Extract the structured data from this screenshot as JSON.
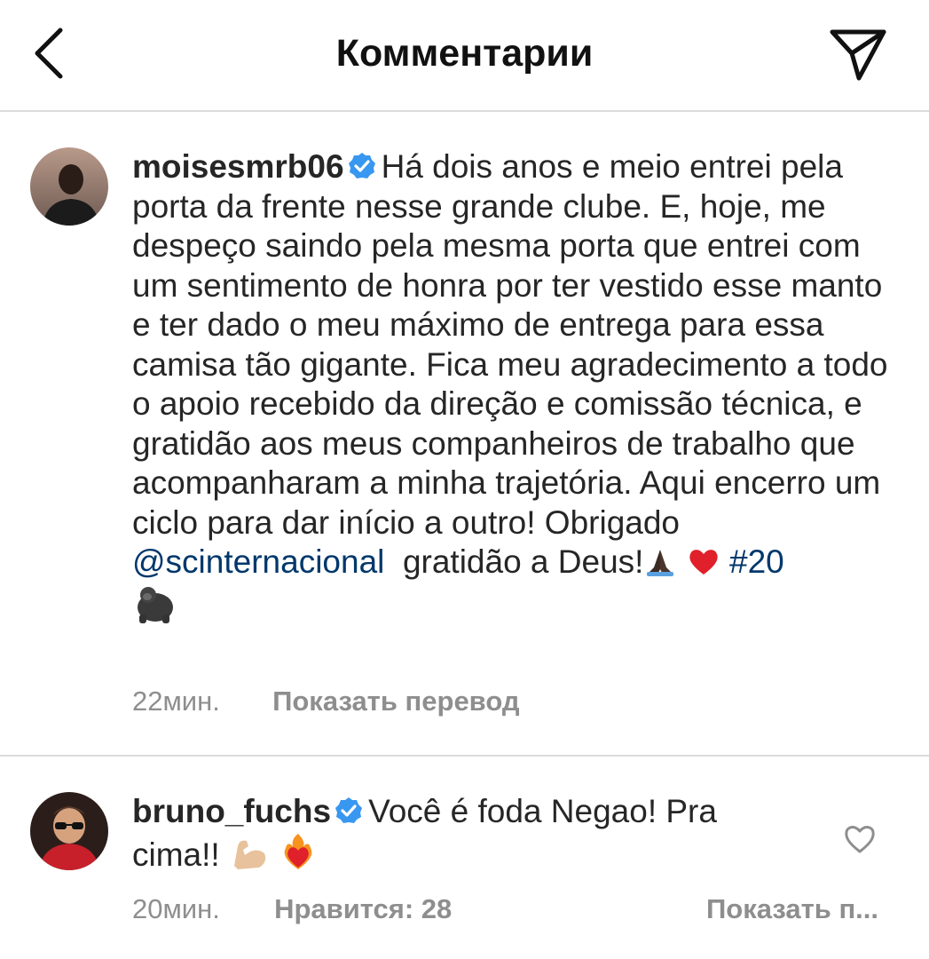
{
  "header": {
    "title": "Комментарии",
    "back_icon": "chevron-left-icon",
    "send_icon": "paper-plane-icon"
  },
  "comments": [
    {
      "username": "moisesmrb06",
      "verified": true,
      "text_before_mention": "Há dois anos e meio entrei pela porta da frente nesse grande clube. E, hoje, me despeço saindo pela mesma porta que entrei com um sentimento de honra por ter vestido esse manto e ter dado o meu máximo de entrega para essa camisa tão gigante. Fica meu agradecimento a todo o apoio recebido da direção e comissão técnica, e gratidão aos meus companheiros de trabalho que acompanharam a minha trajetória. Aqui encerro um ciclo para dar início a outro! Obrigado",
      "mention": "@scinternacional",
      "text_after_mention": "gratidão a Deus!",
      "emojis": [
        "folded-hands-icon",
        "red-heart-icon"
      ],
      "hashtag": "#20",
      "trailing_emoji": "gorilla-icon",
      "time": "22мин.",
      "translate_label": "Показать перевод"
    },
    {
      "username": "bruno_fuchs",
      "verified": true,
      "text": "Você é foda Negao! Pra cima!!",
      "emojis": [
        "flexed-biceps-icon",
        "heart-on-fire-icon"
      ],
      "time": "20мин.",
      "likes_label": "Нравится: 28",
      "truncated_action": "Показать п..."
    }
  ],
  "colors": {
    "text": "#262626",
    "secondary": "#8e8e8e",
    "link": "#00376b",
    "verified": "#3897f0",
    "divider": "#dbdbdb"
  }
}
